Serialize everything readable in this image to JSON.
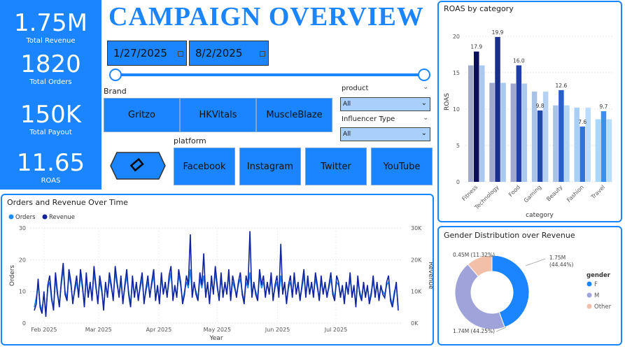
{
  "kpis": {
    "revenue": {
      "value": "1.75M",
      "label": "Total Revenue"
    },
    "orders": {
      "value": "1820",
      "label": "Total Orders"
    },
    "payout": {
      "value": "150K",
      "label": "Total Payout"
    },
    "roas": {
      "value": "11.65",
      "label": "ROAS"
    }
  },
  "header": {
    "title": "CAMPAIGN  OVERVIEW"
  },
  "date_range": {
    "start": "1/27/2025",
    "end": "8/2/2025"
  },
  "brand": {
    "label": "Brand",
    "options": [
      "Gritzo",
      "HKVitals",
      "MuscleBlaze"
    ]
  },
  "product": {
    "label": "product",
    "value": "All"
  },
  "influencer_type": {
    "label": "Influencer Type",
    "value": "All"
  },
  "platform": {
    "label": "platform",
    "options": [
      "Facebook",
      "Instagram",
      "Twitter",
      "YouTube"
    ]
  },
  "colors": {
    "accent": "#1a85ff",
    "orders_line": "#1a8cff",
    "revenue_line": "#12239e"
  },
  "roas_chart": {
    "title": "ROAS by category",
    "chart_data": {
      "type": "bar",
      "title": "ROAS by category",
      "xlabel": "category",
      "ylabel": "ROAS",
      "ylim": [
        0,
        22
      ],
      "yticks": [
        "0",
        "5",
        "10",
        "15",
        "20"
      ],
      "categories": [
        "Fitness",
        "Technology",
        "Food",
        "Gaming",
        "Beauty",
        "Fashion",
        "Travel"
      ],
      "series": [
        {
          "values": [
            16.0,
            13.6,
            13.5,
            12.4,
            10.5,
            10.2,
            8.6
          ],
          "colors": [
            "#a0a8cf",
            "#a0a8cf",
            "#a0a8cf",
            "#a9c3e6",
            "#a9c3e6",
            "#a9cff8",
            "#a9d8ff"
          ]
        },
        {
          "values": [
            17.9,
            19.9,
            16.0,
            9.8,
            12.6,
            7.6,
            9.7
          ],
          "colors": [
            "#0b0f5a",
            "#1a2f8c",
            "#1f3ea8",
            "#2349a8",
            "#2660c8",
            "#2f74d6",
            "#3a90f0"
          ]
        },
        {
          "values": [
            16.0,
            13.6,
            13.5,
            12.4,
            10.5,
            10.2,
            8.6
          ],
          "colors": [
            "#a9c9f0",
            "#a9c9f0",
            "#a9c9f0",
            "#b5d2f2",
            "#b5d5f5",
            "#bcdcff",
            "#bcdcff"
          ]
        }
      ],
      "data_labels": [
        "17.9",
        "19.9",
        "16.0",
        "9.8",
        "12.6",
        "7.6",
        "9.7"
      ]
    }
  },
  "gender_chart": {
    "title": "Gender Distribution over Revenue",
    "chart_data": {
      "type": "pie",
      "title": "Gender Distribution over Revenue",
      "legend_title": "gender",
      "legend_position": "right",
      "slices": [
        {
          "name": "F",
          "value": 44.44,
          "label": "1.75M\n(44.44%)",
          "color": "#1a85ff"
        },
        {
          "name": "M",
          "value": 44.25,
          "label": "1.74M (44.25%)",
          "color": "#a0a3da"
        },
        {
          "name": "Other",
          "value": 11.32,
          "label": "0.45M (11.32%)",
          "color": "#f2bfa8"
        }
      ]
    }
  },
  "time_chart": {
    "title": "Orders and Revenue Over Time",
    "chart_data": {
      "type": "line",
      "title": "Orders and Revenue Over Time",
      "xlabel": "Year",
      "ylabel": "Orders",
      "y2label": "Revenue",
      "ylim": [
        0,
        30
      ],
      "y2lim": [
        0,
        30000
      ],
      "yticks": [
        "0",
        "10",
        "20",
        "30"
      ],
      "y2ticks": [
        "0K",
        "10K",
        "20K",
        "30K"
      ],
      "xticks": [
        "Feb 2025",
        "Mar 2025",
        "Apr 2025",
        "May 2025",
        "Jun 2025",
        "Jul 2025"
      ],
      "x_start": "2025-01-27",
      "x_end": "2025-08-02",
      "series": [
        {
          "name": "Orders",
          "color": "#1a8cff",
          "values": [
            5,
            8,
            12,
            6,
            4,
            9,
            3,
            11,
            13,
            7,
            5,
            14,
            9,
            6,
            12,
            17,
            10,
            8,
            15,
            12,
            7,
            10,
            13,
            9,
            15,
            11,
            6,
            14,
            9,
            12,
            8,
            16,
            11,
            7,
            13,
            10,
            5,
            12,
            9,
            14,
            11,
            8,
            16,
            12,
            9,
            13,
            7,
            11,
            15,
            10,
            6,
            13,
            9,
            12,
            8,
            11,
            14,
            7,
            10,
            13,
            9,
            12,
            15,
            8,
            11,
            7,
            14,
            10,
            12,
            9,
            13,
            16,
            8,
            11,
            9,
            15,
            12,
            7,
            10,
            13,
            11,
            17,
            9,
            12,
            10,
            8,
            14,
            11,
            15,
            9,
            12,
            7,
            13,
            10,
            16,
            11,
            8,
            14,
            9,
            12,
            10,
            15,
            8,
            13,
            11,
            9,
            12,
            14,
            10,
            7,
            13,
            11,
            16,
            9,
            12,
            10,
            8,
            15,
            11,
            13,
            9,
            12,
            10,
            14,
            8,
            11,
            13,
            9,
            15,
            10,
            12,
            7,
            11,
            13,
            9,
            14,
            10,
            12,
            8,
            11,
            15,
            9,
            13,
            10,
            12,
            9,
            14,
            11,
            8,
            13,
            10,
            12,
            9,
            11,
            14,
            10,
            8,
            13,
            12,
            9,
            11,
            7,
            12,
            10,
            14,
            9,
            11,
            6,
            13,
            10,
            8,
            12,
            9,
            11,
            7,
            10,
            13,
            9,
            12,
            8,
            11,
            10,
            9,
            12,
            13,
            8,
            6,
            10,
            12,
            5
          ]
        },
        {
          "name": "Revenue",
          "color": "#12239e",
          "values": [
            4000,
            6000,
            14000,
            5000,
            3000,
            10000,
            2000,
            12000,
            15000,
            8000,
            4000,
            16000,
            10000,
            5000,
            13000,
            19000,
            9000,
            7000,
            17000,
            13000,
            6000,
            11000,
            15000,
            8000,
            17000,
            12000,
            5000,
            16000,
            8000,
            13000,
            7000,
            18000,
            12000,
            6000,
            15000,
            11000,
            4000,
            13000,
            8000,
            16000,
            12000,
            7000,
            18000,
            13000,
            8000,
            15000,
            6000,
            12000,
            17000,
            9000,
            5000,
            15000,
            8000,
            13000,
            7000,
            12000,
            16000,
            6000,
            11000,
            15000,
            8000,
            13000,
            17000,
            7000,
            12000,
            6000,
            16000,
            9000,
            13000,
            8000,
            15000,
            18000,
            7000,
            12000,
            8000,
            17000,
            13000,
            6000,
            9000,
            15000,
            12000,
            28000,
            8000,
            13000,
            9000,
            7000,
            16000,
            12000,
            22000,
            8000,
            13000,
            6000,
            15000,
            9000,
            18000,
            12000,
            7000,
            16000,
            8000,
            13000,
            9000,
            17000,
            7000,
            15000,
            12000,
            8000,
            13000,
            16000,
            9000,
            6000,
            15000,
            12000,
            29000,
            8000,
            13000,
            9000,
            7000,
            17000,
            12000,
            15000,
            8000,
            13000,
            9000,
            16000,
            7000,
            12000,
            15000,
            8000,
            25000,
            9000,
            13000,
            6000,
            12000,
            15000,
            8000,
            16000,
            9000,
            13000,
            7000,
            12000,
            17000,
            8000,
            15000,
            9000,
            13000,
            8000,
            16000,
            12000,
            7000,
            15000,
            9000,
            13000,
            8000,
            12000,
            16000,
            9000,
            7000,
            15000,
            13000,
            8000,
            12000,
            6000,
            13000,
            9000,
            16000,
            8000,
            12000,
            5000,
            15000,
            9000,
            7000,
            13000,
            8000,
            12000,
            6000,
            9000,
            15000,
            8000,
            13000,
            7000,
            12000,
            9000,
            8000,
            13000,
            15000,
            7000,
            5000,
            9000,
            13000,
            4000
          ]
        }
      ]
    }
  }
}
